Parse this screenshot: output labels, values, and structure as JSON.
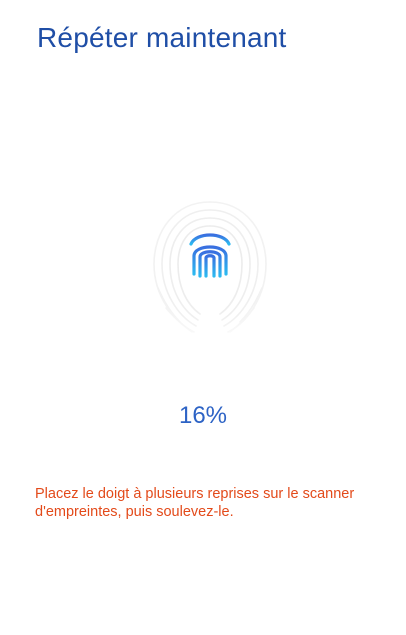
{
  "screen": {
    "title": "Répéter maintenant",
    "progress_percent": 16,
    "progress_label": "16%",
    "instruction": "Placez le doigt à plusieurs reprises sur le scanner d'empreintes, puis soulevez-le."
  },
  "icons": {
    "fingerprint": "fingerprint-icon",
    "fingerprint_scan_area": "fingerprint-scan-pattern"
  },
  "colors": {
    "title": "#1f4ea6",
    "progress_text": "#2d63c5",
    "instruction_text": "#e34a1a",
    "fingerprint_gradient_top": "#3a6fe0",
    "fingerprint_gradient_bottom": "#2db9f0",
    "pattern_lines": "#ececec"
  }
}
